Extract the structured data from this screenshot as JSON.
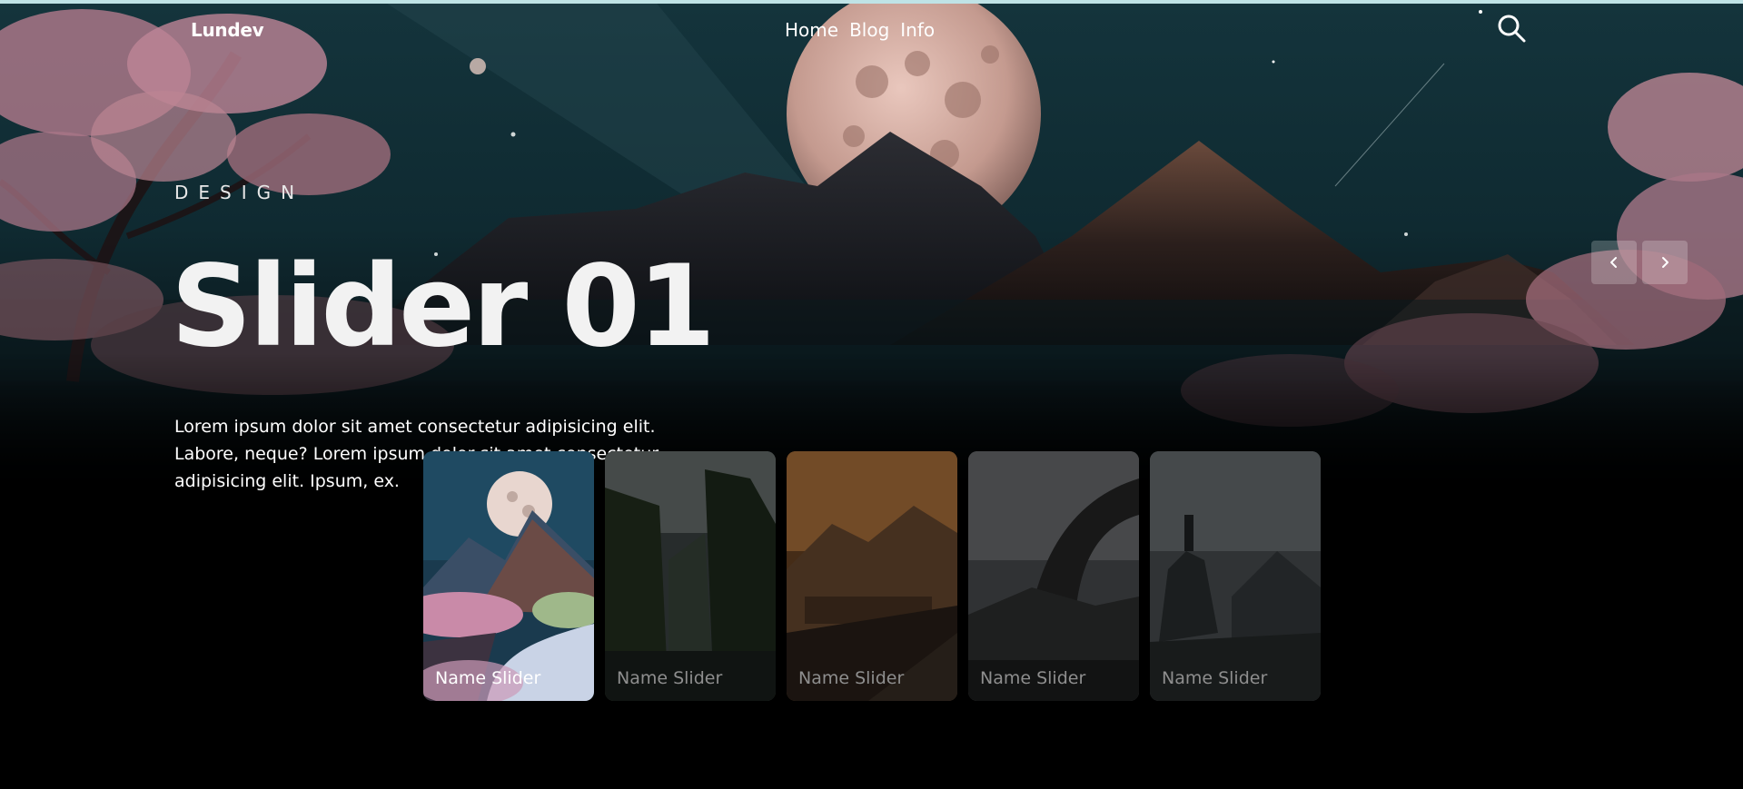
{
  "header": {
    "brand": "Lundev",
    "nav": [
      "Home",
      "Blog",
      "Info"
    ],
    "search_icon": "search-icon"
  },
  "hero": {
    "kicker": "DESIGN",
    "title": "Slider 01",
    "description": "Lorem ipsum dolor sit amet consectetur adipisicing elit. Labore, neque? Lorem ipsum dolor sit amet consectetur adipisicing elit. Ipsum, ex."
  },
  "controls": {
    "prev_icon": "chevron-left-icon",
    "next_icon": "chevron-right-icon"
  },
  "thumbnails": [
    {
      "label": "Name Slider",
      "active": true
    },
    {
      "label": "Name Slider",
      "active": false
    },
    {
      "label": "Name Slider",
      "active": false
    },
    {
      "label": "Name Slider",
      "active": false
    },
    {
      "label": "Name Slider",
      "active": false
    }
  ],
  "colors": {
    "accent_line": "#bfe3e6",
    "sky": "#0f2c33",
    "blossom": "#c88a9c"
  }
}
